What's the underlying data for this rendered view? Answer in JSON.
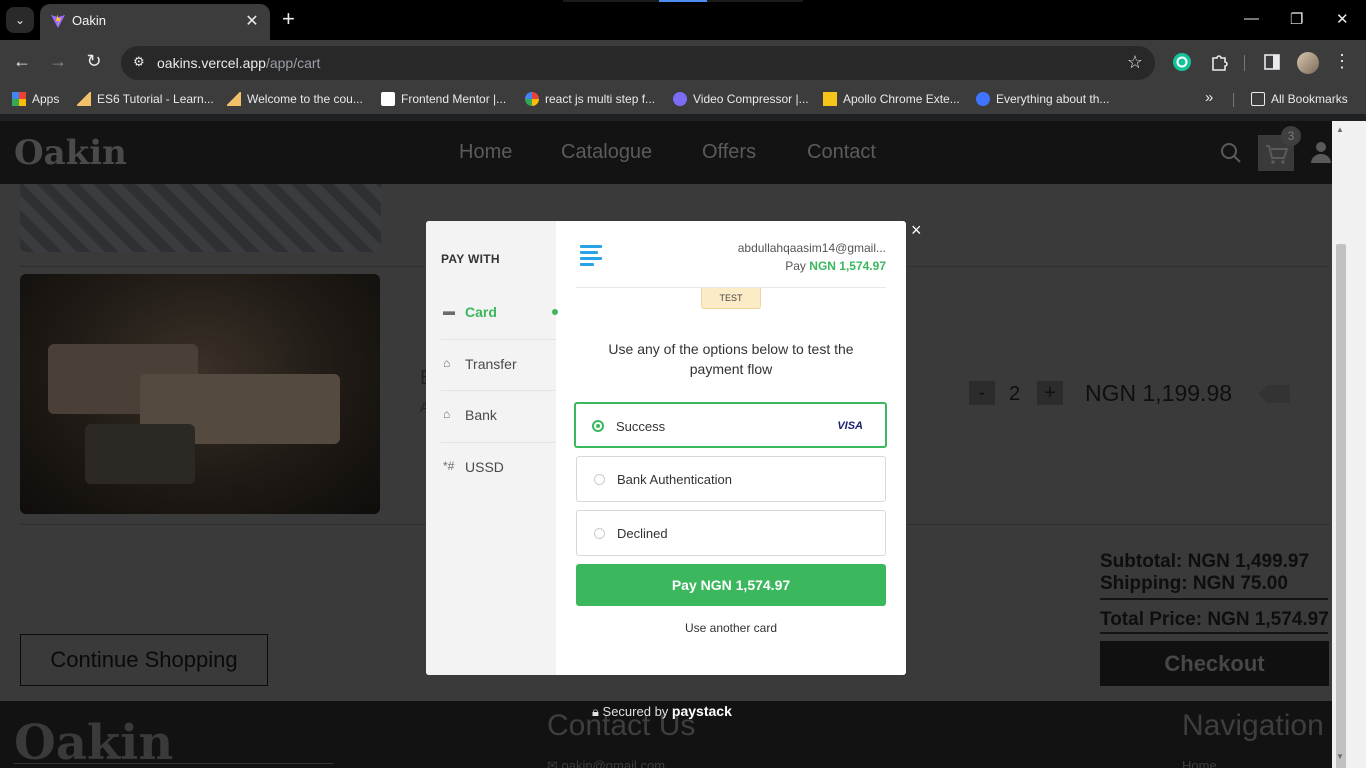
{
  "browser": {
    "tab_title": "Oakin",
    "url_host": "oakins.vercel.app",
    "url_path": "/app/cart",
    "bookmarks": [
      "Apps",
      "ES6 Tutorial - Learn...",
      "Welcome to the cou...",
      "Frontend Mentor |...",
      "react js multi step f...",
      "Video Compressor |...",
      "Apollo Chrome Exte...",
      "Everything about th..."
    ],
    "all_bookmarks": "All Bookmarks",
    "more_bookmarks": "»"
  },
  "site": {
    "logo": "Oakin",
    "nav": [
      "Home",
      "Catalogue",
      "Offers",
      "Contact"
    ],
    "cart_count": "3"
  },
  "cart": {
    "item_qty": "2",
    "item_price": "NGN 1,199.98",
    "minus": "-",
    "plus": "+",
    "subtotal": "Subtotal: NGN 1,499.97",
    "shipping": "Shipping: NGN 75.00",
    "total": "Total Price: NGN 1,574.97",
    "checkout": "Checkout",
    "continue": "Continue Shopping"
  },
  "footer": {
    "logo": "Oakin",
    "contact_heading": "Contact Us",
    "contact_email": "oakin@gmail.com",
    "nav_heading": "Navigation",
    "nav_first": "Home"
  },
  "paystack": {
    "pay_with": "PAY WITH",
    "methods": [
      {
        "label": "Card",
        "icon": "card-icon"
      },
      {
        "label": "Transfer",
        "icon": "bank-transfer-icon"
      },
      {
        "label": "Bank",
        "icon": "bank-icon"
      },
      {
        "label": "USSD",
        "icon": "ussd-icon"
      }
    ],
    "active_method": "Card",
    "email": "abdullahqaasim14@gmail...",
    "pay_label": "Pay",
    "amount": "NGN 1,574.97",
    "test_badge": "TEST",
    "instructions": "Use any of the options below to test the payment flow",
    "options": [
      "Success",
      "Bank Authentication",
      "Declined"
    ],
    "selected_option": "Success",
    "visa": "VISA",
    "pay_button": "Pay NGN 1,574.97",
    "another_card": "Use another card",
    "secured_by": "Secured by",
    "brand": "paystack",
    "close": "×"
  },
  "colors": {
    "accent_green": "#3bb75e",
    "paystack_blue": "#29a3e8"
  }
}
